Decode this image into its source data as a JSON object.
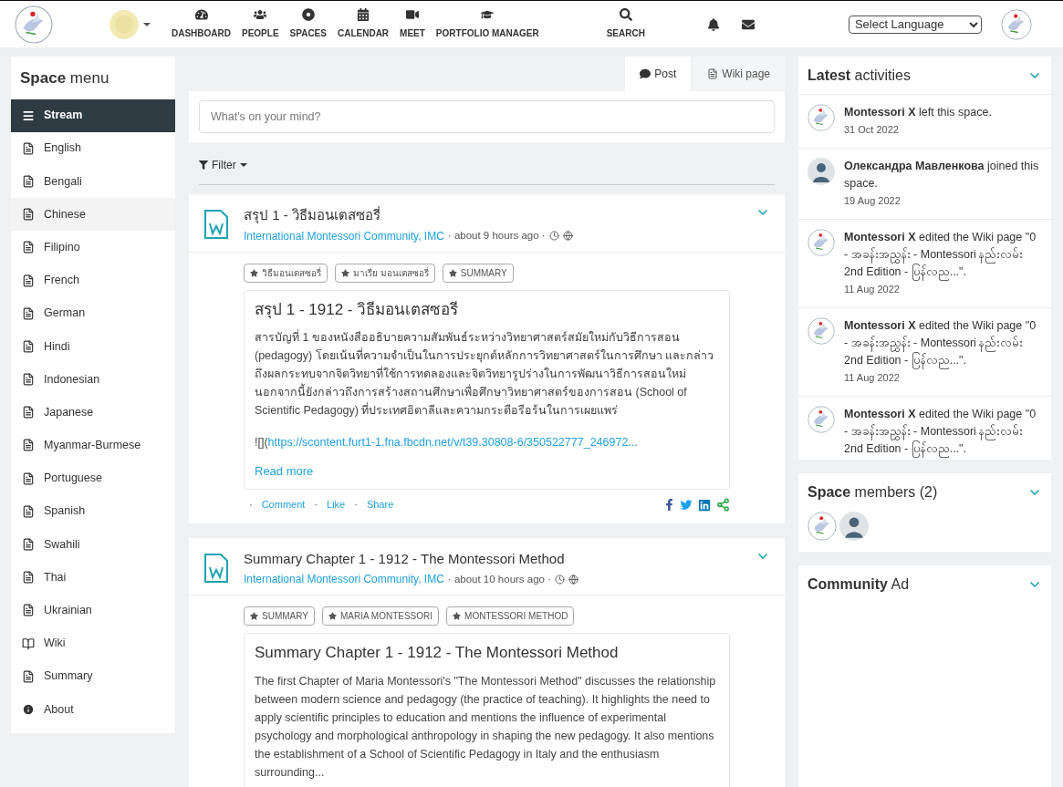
{
  "nav": {
    "items": [
      "DASHBOARD",
      "PEOPLE",
      "SPACES",
      "CALENDAR",
      "MEET",
      "PORTFOLIO MANAGER"
    ],
    "search": "SEARCH",
    "language": "Select Language"
  },
  "space_menu": {
    "title": "**Space** menu",
    "items": [
      {
        "label": "Stream",
        "kind": "stream",
        "selected": true,
        "hovered": false
      },
      {
        "label": "English",
        "kind": "page",
        "selected": false,
        "hovered": false
      },
      {
        "label": "Bengali",
        "kind": "page",
        "selected": false,
        "hovered": false
      },
      {
        "label": "Chinese",
        "kind": "page",
        "selected": false,
        "hovered": true
      },
      {
        "label": "Filipino",
        "kind": "page",
        "selected": false,
        "hovered": false
      },
      {
        "label": "French",
        "kind": "page",
        "selected": false,
        "hovered": false
      },
      {
        "label": "German",
        "kind": "page",
        "selected": false,
        "hovered": false
      },
      {
        "label": "Hindi",
        "kind": "page",
        "selected": false,
        "hovered": false
      },
      {
        "label": "Indonesian",
        "kind": "page",
        "selected": false,
        "hovered": false
      },
      {
        "label": "Japanese",
        "kind": "page",
        "selected": false,
        "hovered": false
      },
      {
        "label": "Myanmar-Burmese",
        "kind": "page",
        "selected": false,
        "hovered": false
      },
      {
        "label": "Portuguese",
        "kind": "page",
        "selected": false,
        "hovered": false
      },
      {
        "label": "Spanish",
        "kind": "page",
        "selected": false,
        "hovered": false
      },
      {
        "label": "Swahili",
        "kind": "page",
        "selected": false,
        "hovered": false
      },
      {
        "label": "Thai",
        "kind": "page",
        "selected": false,
        "hovered": false
      },
      {
        "label": "Ukrainian",
        "kind": "page",
        "selected": false,
        "hovered": false
      },
      {
        "label": "Wiki",
        "kind": "wiki",
        "selected": false,
        "hovered": false
      },
      {
        "label": "Summary",
        "kind": "page",
        "selected": false,
        "hovered": false
      },
      {
        "label": "About",
        "kind": "info",
        "selected": false,
        "hovered": false
      }
    ]
  },
  "tabs": [
    {
      "label": "Post",
      "selected": true
    },
    {
      "label": "Wiki page",
      "selected": false
    }
  ],
  "composer": {
    "placeholder": "What's on your mind?"
  },
  "filter": "Filter",
  "posts": [
    {
      "title": "สรุป 1 - วิธีมอนเตสซอรี่",
      "space": "International Montessori Community, IMC",
      "time": "· about 9 hours ago ·",
      "tags": [
        "วิธีมอนเตสซอรี่",
        "มาเรีย มอนเตสซอรี่",
        "SUMMARY"
      ],
      "heading": "สรุป 1 - 1912 - วิธีมอนเตสซอรี",
      "body": "สารบัญที่ 1 ของหนังสืออธิบายความสัมพันธ์ระหว่างวิทยาศาสตร์สมัยใหม่กับวิธีการสอน (pedagogy) โดยเน้นที่ความจำเป็นในการประยุกต์หลักการวิทยาศาสตร์ในการศึกษา และกล่าวถึงผลกระทบจากจิตวิทยาที่ใช้การทดลองและจิตวิทยารูปร่างในการพัฒนาวิธีการสอนใหม่ นอกจากนี้ยังกล่าวถึงการสร้างสถานศึกษาเพื่อศึกษาวิทยาศาสตร์ของการสอน (School of Scientific Pedagogy) ที่ประเทศอิตาลีและความกระตือรือร้นในการเผยแพร่",
      "link_prefix": "![](",
      "link": "https://scontent.furt1-1.fna.fbcdn.net/v/t39.30808-6/350522777_246972...",
      "read_more": "Read more",
      "action_separator": "·",
      "actions": [
        "Comment",
        "Like",
        "Share"
      ]
    },
    {
      "title": "Summary Chapter 1 - 1912 - The Montessori Method",
      "space": "International Montessori Community, IMC",
      "time": "· about 10 hours ago ·",
      "tags": [
        "SUMMARY",
        "MARIA MONTESSORI",
        "MONTESSORI METHOD"
      ],
      "heading": "Summary Chapter 1 - 1912 - The Montessori Method",
      "body": "The first Chapter of Maria Montessori's \"The Montessori Method\" discusses the relationship between modern science and pedagogy (the practice of teaching). It highlights the need to apply scientific principles to education and mentions the influence of experimental psychology and morphological anthropology in shaping the new pedagogy. It also mentions the establishment of a School of Scientific Pedagogy in Italy and the enthusiasm surrounding..."
    }
  ],
  "activities": {
    "title": "**Latest** activities",
    "items": [
      {
        "user": "Montessori X",
        "action": "left this space.",
        "date": "31 Oct 2022",
        "kind": "logo"
      },
      {
        "user": "Олександра Мавленкова",
        "action": "joined this space.",
        "date": "19 Aug 2022",
        "kind": "person"
      },
      {
        "user": "Montessori X",
        "action": "edited the Wiki page \"0 - အခန်းအညွှန်း - Montessori နည်းလမ်း 2nd Edition - ပြန်လည...\".",
        "date": "11 Aug 2022",
        "kind": "logo"
      },
      {
        "user": "Montessori X",
        "action": "edited the Wiki page \"0 - အခန်းအညွှန်း - Montessori နည်းလမ်း 2nd Edition - ပြန်လည...\".",
        "date": "11 Aug 2022",
        "kind": "logo"
      },
      {
        "user": "Montessori X",
        "action": "edited the Wiki page \"0 - အခန်းအညွှန်း - Montessori နည်းလမ်း 2nd Edition - ပြန်လည...\".",
        "kind": "logo"
      }
    ]
  },
  "members": {
    "title": "**Space** members (2)",
    "items": [
      {
        "kind": "logo"
      },
      {
        "kind": "person"
      }
    ]
  },
  "ad": {
    "title": "**Community** Ad"
  }
}
